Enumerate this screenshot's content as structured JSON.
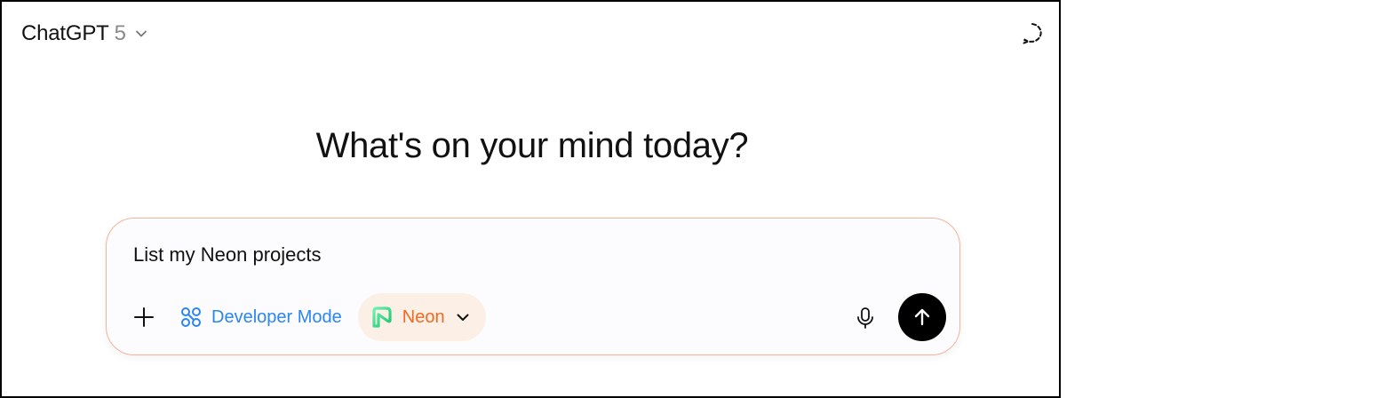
{
  "header": {
    "model_name": "ChatGPT",
    "model_version": "5",
    "model_chevron_icon": "chevron-down-icon",
    "temporary_chat_icon": "dashed-circle-icon"
  },
  "main": {
    "headline": "What's on your mind today?"
  },
  "composer": {
    "prompt_text": "List my Neon projects",
    "plus_icon": "plus-icon",
    "developer_mode_label": "Developer Mode",
    "developer_mode_icon": "connectors-icon",
    "connector": {
      "label": "Neon",
      "icon": "neon-logo-icon",
      "chevron_icon": "chevron-down-icon"
    },
    "mic_icon": "microphone-icon",
    "send_icon": "arrow-up-icon"
  },
  "colors": {
    "developer_mode": "#2b86f0",
    "neon_label": "#f26a21",
    "neon_chip_bg": "#fcefe6",
    "composer_border": "#f2b59a",
    "send_button_bg": "#000000"
  }
}
